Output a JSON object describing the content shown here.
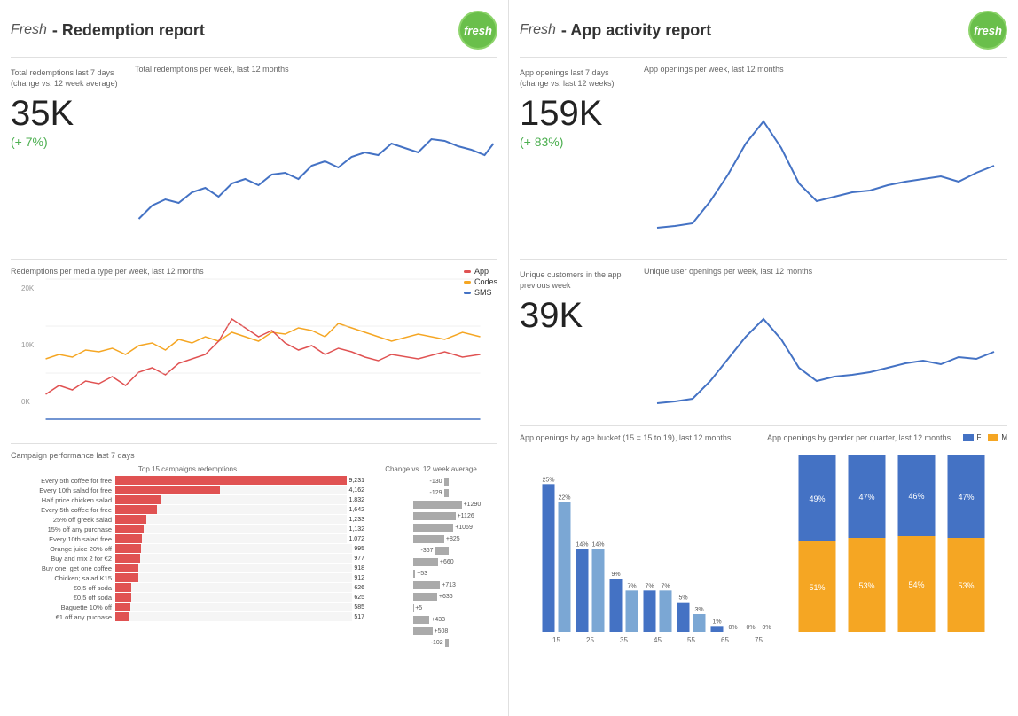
{
  "left": {
    "brand": "Fresh",
    "title": "- Redemption report",
    "logo_text": "fresh",
    "top": {
      "metric_label": "Total redemptions last 7 days\n(change vs. 12 week average)",
      "chart_label": "Total redemptions per week, last 12 months",
      "metric_value": "35K",
      "metric_change": "(+ 7%)"
    },
    "mid": {
      "label": "Redemptions per media type per week, last 12 months",
      "legend": [
        {
          "color": "#e05252",
          "label": "App"
        },
        {
          "color": "#f5a623",
          "label": "Codes"
        },
        {
          "color": "#4472c4",
          "label": "SMS"
        }
      ],
      "y_labels": [
        "20K",
        "10K",
        "0K"
      ]
    },
    "campaigns": {
      "label": "Campaign performance last 7 days",
      "top_label": "Top 15 campaigns redemptions",
      "change_label": "Change vs. 12 week average",
      "rows": [
        {
          "name": "Every 5th coffee for free",
          "value": 9231,
          "max": 9231,
          "change": -130
        },
        {
          "name": "Every 10th salad for free",
          "value": 4162,
          "max": 9231,
          "change": -129
        },
        {
          "name": "Half price chicken salad",
          "value": 1832,
          "max": 9231,
          "change": 1290
        },
        {
          "name": "Every 5th coffee for free",
          "value": 1642,
          "max": 9231,
          "change": 1126
        },
        {
          "name": "25% off greek salad",
          "value": 1233,
          "max": 9231,
          "change": 1069
        },
        {
          "name": "15% off any purchase",
          "value": 1132,
          "max": 9231,
          "change": 825
        },
        {
          "name": "Every 10th salad free",
          "value": 1072,
          "max": 9231,
          "change": -367
        },
        {
          "name": "Orange juice 20% off",
          "value": 995,
          "max": 9231,
          "change": 660
        },
        {
          "name": "Buy and mix 2 for €2",
          "value": 977,
          "max": 9231,
          "change": 53
        },
        {
          "name": "Buy one, get one coffee",
          "value": 918,
          "max": 9231,
          "change": 713
        },
        {
          "name": "Chicken; salad K15",
          "value": 912,
          "max": 9231,
          "change": 636
        },
        {
          "name": "€0,5 off soda",
          "value": 626,
          "max": 9231,
          "change": 5
        },
        {
          "name": "€0,5 off soda",
          "value": 625,
          "max": 9231,
          "change": 433
        },
        {
          "name": "Baguette 10% off",
          "value": 585,
          "max": 9231,
          "change": 508
        },
        {
          "name": "€1 off any puchase",
          "value": 517,
          "max": 9231,
          "change": -102
        }
      ]
    }
  },
  "right": {
    "brand": "Fresh",
    "title": "- App activity report",
    "logo_text": "fresh",
    "top": {
      "metric_label": "App openings last 7 days\n(change vs. last 12 weeks)",
      "chart_label": "App openings per week, last 12 months",
      "metric_value": "159K",
      "metric_change": "(+ 83%)"
    },
    "mid": {
      "metric_label": "Unique customers in the app previous week",
      "chart_label": "Unique user openings per week, last 12 months",
      "metric_value": "39K"
    },
    "age": {
      "label": "App openings by age bucket (15 = 15 to 19), last 12 months",
      "buckets": [
        {
          "age": "15",
          "f": 25,
          "m": 22
        },
        {
          "age": "25",
          "f": 14,
          "m": 14
        },
        {
          "age": "35",
          "f": 9,
          "m": 7
        },
        {
          "age": "45",
          "f": 7,
          "m": 7
        },
        {
          "age": "55",
          "f": 5,
          "m": 3
        },
        {
          "age": "65",
          "f": 1,
          "m": 0
        },
        {
          "age": "75",
          "f": 0,
          "m": 0
        }
      ]
    },
    "gender": {
      "label": "App openings by gender per quarter, last 12 months",
      "legend": [
        {
          "color": "#4472c4",
          "label": "F"
        },
        {
          "color": "#f5a623",
          "label": "M"
        }
      ],
      "quarters": [
        {
          "f": 49,
          "m": 51
        },
        {
          "f": 47,
          "m": 53
        },
        {
          "f": 46,
          "m": 54
        },
        {
          "f": 47,
          "m": 53
        }
      ]
    }
  }
}
